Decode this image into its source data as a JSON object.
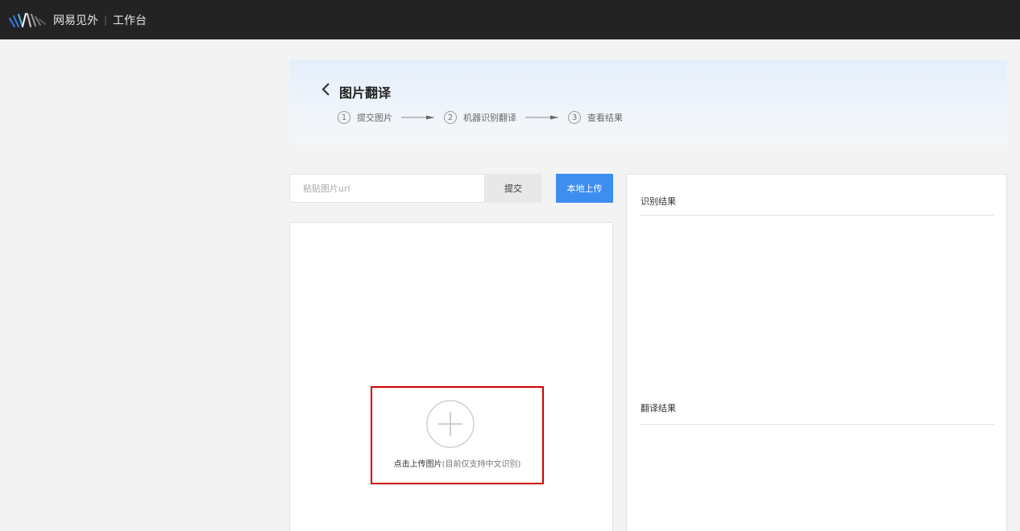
{
  "topbar": {
    "brand": "网易见外",
    "separator": "|",
    "section": "工作台",
    "logo_icon": "waveform-logo-icon"
  },
  "header": {
    "back_icon": "chevron-left-icon",
    "title": "图片翻译",
    "steps": [
      {
        "num": "1",
        "label": "提交图片"
      },
      {
        "num": "2",
        "label": "机器识别翻译"
      },
      {
        "num": "3",
        "label": "查看结果"
      }
    ],
    "step_arrow_icon": "long-arrow-right-icon"
  },
  "input": {
    "url_placeholder": "粘贴图片url",
    "url_value": "",
    "submit_label": "提交",
    "upload_label": "本地上传"
  },
  "upload": {
    "plus_icon": "plus-circle-icon",
    "hint_strong": "点击上传图片",
    "hint_light": "(目前仅支持中文识别)"
  },
  "results": {
    "recognition_title": "识别结果",
    "translation_title": "翻译结果"
  },
  "colors": {
    "topbar": "#232323",
    "accent": "#3d8ef0",
    "highlight_border": "#d00000",
    "logo_blue": "#2f7fe6"
  }
}
